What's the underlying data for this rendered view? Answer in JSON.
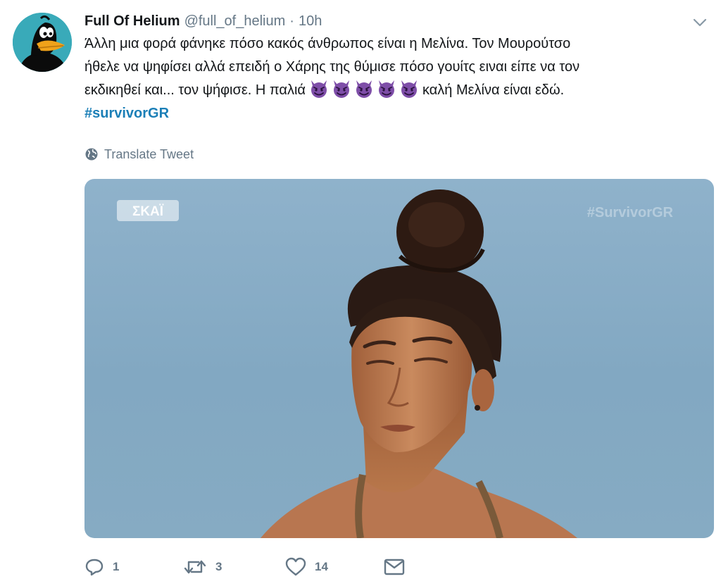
{
  "tweet": {
    "author": {
      "display_name": "Full Of Helium",
      "handle": "@full_of_helium",
      "separator": "·",
      "time": "10h",
      "avatar_icon": "daffy-duck-avatar"
    },
    "text_lines": [
      "Άλλη μια φορά φάνηκε πόσο κακός άνθρωπος είναι η Μελίνα. Τον Μουρούτσο",
      "ήθελε να ψηφίσει αλλά επειδή ο Χάρης της θύμισε πόσο γουίτς ειναι είπε να τον",
      "εκδικηθεί και... τον ψήφισε. Η παλιά",
      "καλή Μελίνα είναι εδώ."
    ],
    "emoji_icon": "smiling-devil-emoji",
    "emoji_count": 5,
    "hashtag": "#survivorGR",
    "translate_label": "Translate Tweet",
    "media": {
      "logo_text": "ΣΚΑΪ",
      "watermark": "#SurvivorGR"
    },
    "actions": {
      "reply_count": "1",
      "retweet_count": "3",
      "like_count": "14"
    },
    "colors": {
      "link": "#1b7fb7",
      "meta": "#657786",
      "emoji": "#7e4ea8",
      "avatar_bg": "#39aab9"
    }
  }
}
